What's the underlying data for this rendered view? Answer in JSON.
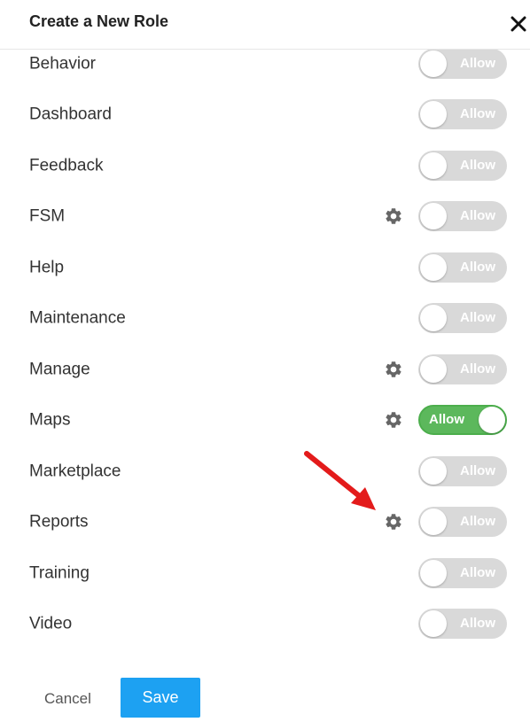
{
  "header": {
    "title": "Create a New Role"
  },
  "toggle_label": "Allow",
  "colors": {
    "toggle_off": "#d9d9d9",
    "toggle_on": "#5cb85c",
    "save": "#1da1f2",
    "arrow": "#e31b1b"
  },
  "permissions": [
    {
      "label": "Behavior",
      "gear": false,
      "allowed": false
    },
    {
      "label": "Dashboard",
      "gear": false,
      "allowed": false
    },
    {
      "label": "Feedback",
      "gear": false,
      "allowed": false
    },
    {
      "label": "FSM",
      "gear": true,
      "allowed": false
    },
    {
      "label": "Help",
      "gear": false,
      "allowed": false
    },
    {
      "label": "Maintenance",
      "gear": false,
      "allowed": false
    },
    {
      "label": "Manage",
      "gear": true,
      "allowed": false
    },
    {
      "label": "Maps",
      "gear": true,
      "allowed": true
    },
    {
      "label": "Marketplace",
      "gear": false,
      "allowed": false
    },
    {
      "label": "Reports",
      "gear": true,
      "allowed": false
    },
    {
      "label": "Training",
      "gear": false,
      "allowed": false
    },
    {
      "label": "Video",
      "gear": false,
      "allowed": false
    }
  ],
  "footer": {
    "cancel_label": "Cancel",
    "save_label": "Save"
  }
}
